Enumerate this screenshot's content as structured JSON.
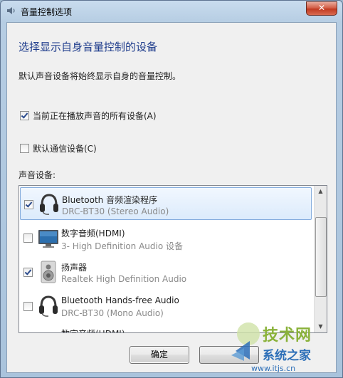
{
  "window": {
    "title": "音量控制选项",
    "close_glyph": "✕"
  },
  "content": {
    "heading": "选择显示自身音量控制的设备",
    "description": "默认声音设备将始终显示自身的音量控制。",
    "option_all_playing": {
      "label": "当前正在播放声音的所有设备(A)",
      "checked": true
    },
    "option_default_comm": {
      "label": "默认通信设备(C)",
      "checked": false
    },
    "section_label": "声音设备:"
  },
  "devices": [
    {
      "name": "Bluetooth 音频渲染程序",
      "sub": "DRC-BT30 (Stereo Audio)",
      "checked": true,
      "icon": "headset-icon",
      "selected": true
    },
    {
      "name": "数字音频(HDMI)",
      "sub": "3- High Definition Audio 设备",
      "checked": false,
      "icon": "monitor-icon",
      "selected": false
    },
    {
      "name": "扬声器",
      "sub": "Realtek High Definition Audio",
      "checked": true,
      "icon": "speaker-icon",
      "selected": false
    },
    {
      "name": "Bluetooth Hands-free Audio",
      "sub": "DRC-BT30 (Mono Audio)",
      "checked": false,
      "icon": "headset-icon",
      "selected": false
    },
    {
      "name": "数字音频(HDMI)",
      "sub": "",
      "checked": false,
      "icon": "monitor-icon",
      "selected": false
    }
  ],
  "buttons": {
    "ok": "确定"
  },
  "watermark": {
    "line1": "技术网",
    "line2": "系统之家",
    "url": "www.itjs.cn"
  },
  "colors": {
    "heading": "#1e3c8c",
    "close_button": "#c13a22",
    "selection": "#dcebfc"
  }
}
